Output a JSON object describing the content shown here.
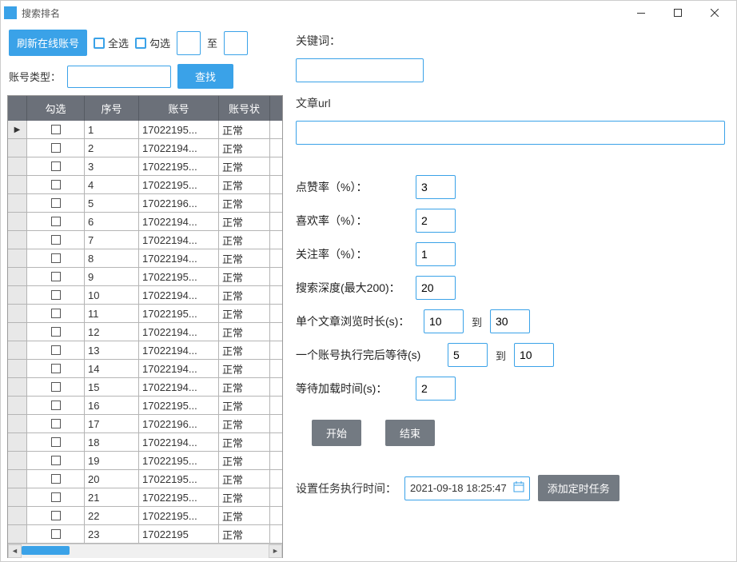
{
  "window": {
    "title": "搜索排名"
  },
  "top": {
    "refresh_btn": "刷新在线账号",
    "select_all": "全选",
    "check_sel": "勾选",
    "to": "至"
  },
  "filter": {
    "account_type_label": "账号类型：",
    "search_btn": "查找"
  },
  "grid": {
    "headers": {
      "check": "勾选",
      "index": "序号",
      "account": "账号",
      "status": "账号状"
    },
    "rows": [
      {
        "idx": "1",
        "account": "17022195...",
        "status": "正常"
      },
      {
        "idx": "2",
        "account": "17022194...",
        "status": "正常"
      },
      {
        "idx": "3",
        "account": "17022195...",
        "status": "正常"
      },
      {
        "idx": "4",
        "account": "17022195...",
        "status": "正常"
      },
      {
        "idx": "5",
        "account": "17022196...",
        "status": "正常"
      },
      {
        "idx": "6",
        "account": "17022194...",
        "status": "正常"
      },
      {
        "idx": "7",
        "account": "17022194...",
        "status": "正常"
      },
      {
        "idx": "8",
        "account": "17022194...",
        "status": "正常"
      },
      {
        "idx": "9",
        "account": "17022195...",
        "status": "正常"
      },
      {
        "idx": "10",
        "account": "17022194...",
        "status": "正常"
      },
      {
        "idx": "11",
        "account": "17022195...",
        "status": "正常"
      },
      {
        "idx": "12",
        "account": "17022194...",
        "status": "正常"
      },
      {
        "idx": "13",
        "account": "17022194...",
        "status": "正常"
      },
      {
        "idx": "14",
        "account": "17022194...",
        "status": "正常"
      },
      {
        "idx": "15",
        "account": "17022194...",
        "status": "正常"
      },
      {
        "idx": "16",
        "account": "17022195...",
        "status": "正常"
      },
      {
        "idx": "17",
        "account": "17022196...",
        "status": "正常"
      },
      {
        "idx": "18",
        "account": "17022194...",
        "status": "正常"
      },
      {
        "idx": "19",
        "account": "17022195...",
        "status": "正常"
      },
      {
        "idx": "20",
        "account": "17022195...",
        "status": "正常"
      },
      {
        "idx": "21",
        "account": "17022195...",
        "status": "正常"
      },
      {
        "idx": "22",
        "account": "17022195...",
        "status": "正常"
      },
      {
        "idx": "23",
        "account": "17022195",
        "status": "正常"
      }
    ]
  },
  "form": {
    "keyword_label": "关键词：",
    "url_label": "文章url",
    "like_rate_label": "点赞率（%）：",
    "like_rate": "3",
    "fav_rate_label": "喜欢率（%）：",
    "fav_rate": "2",
    "follow_rate_label": "关注率（%）：",
    "follow_rate": "1",
    "depth_label": "搜索深度(最大200)：",
    "depth": "20",
    "browse_label": "单个文章浏览时长(s)：",
    "browse_from": "10",
    "browse_to_label": "到",
    "browse_to": "30",
    "account_wait_label": "一个账号执行完后等待(s)",
    "account_wait_from": "5",
    "account_wait_to_label": "到",
    "account_wait_to": "10",
    "load_wait_label": "等待加载时间(s)：",
    "load_wait": "2",
    "start_btn": "开始",
    "end_btn": "结束",
    "schedule_label": "设置任务执行时间：",
    "schedule_time": "2021-09-18 18:25:47",
    "add_schedule_btn": "添加定时任务"
  }
}
